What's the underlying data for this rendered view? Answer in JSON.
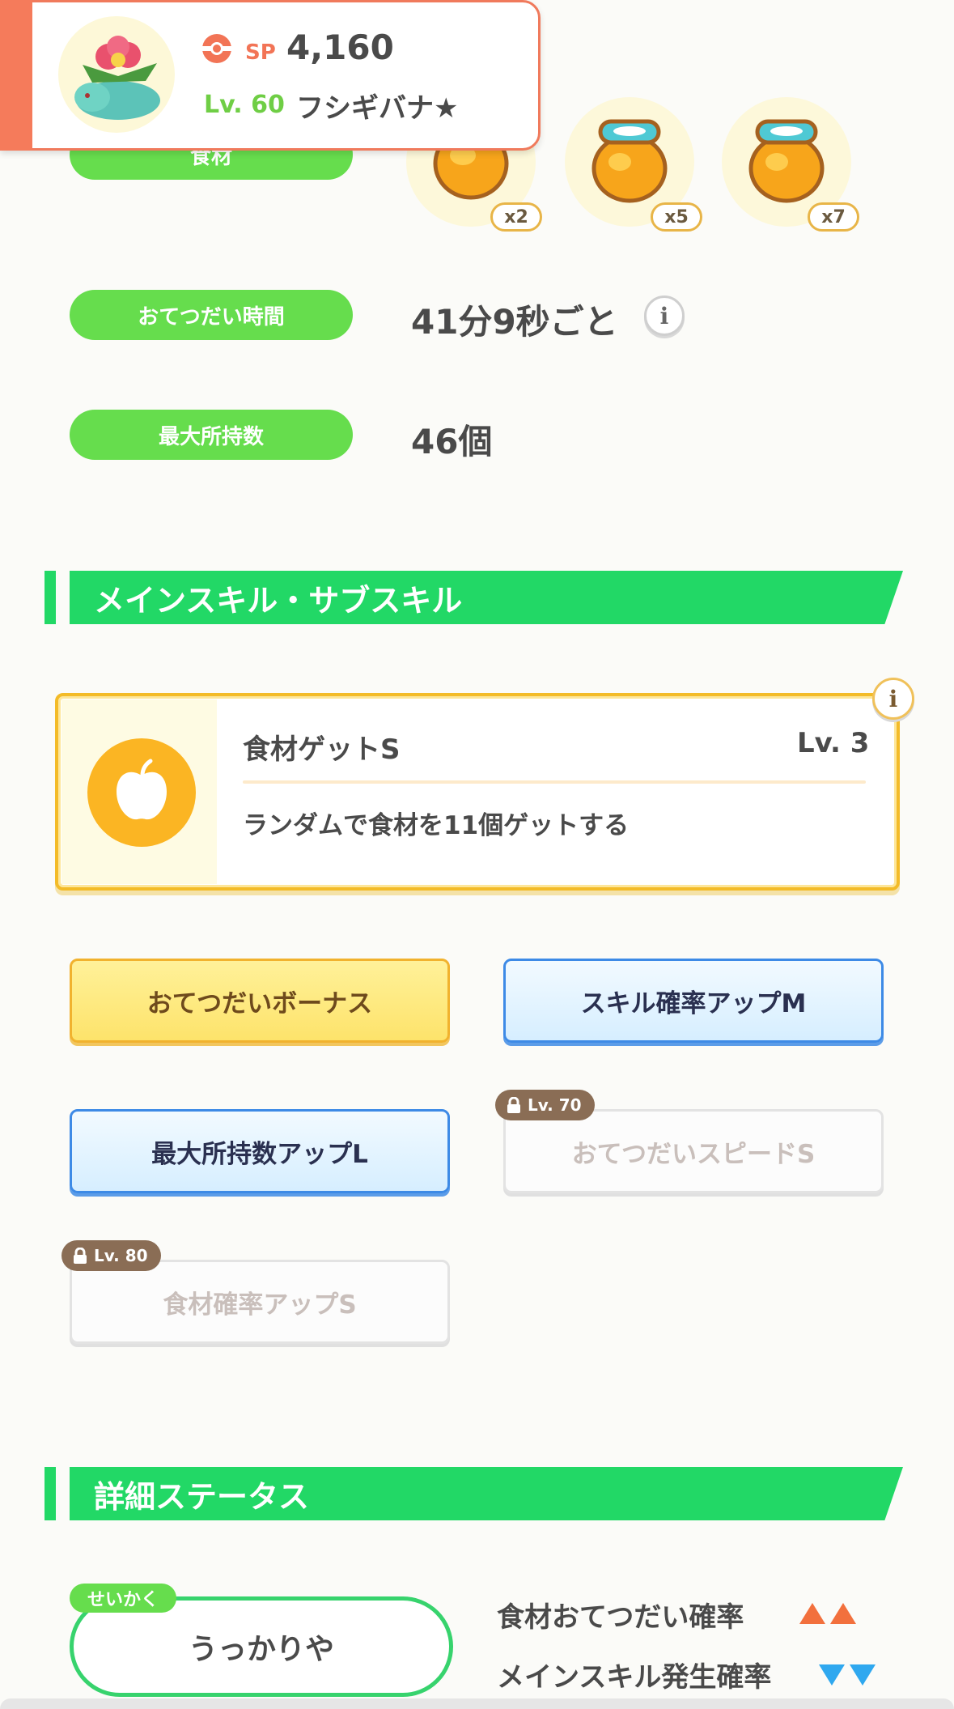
{
  "header": {
    "sp_label": "SP",
    "sp_value": "4,160",
    "level": "Lv. 60",
    "name": "フシギバナ★",
    "accent_color": "#f57b5b"
  },
  "ingredients": {
    "label": "食材",
    "items": [
      {
        "icon": "honey-jar-icon",
        "count": "x2"
      },
      {
        "icon": "honey-jar-icon",
        "count": "x5"
      },
      {
        "icon": "honey-jar-icon",
        "count": "x7"
      }
    ]
  },
  "help_time": {
    "label": "おてつだい時間",
    "value": "41分9秒ごと"
  },
  "max_carry": {
    "label": "最大所持数",
    "value": "46個"
  },
  "skills_section": {
    "title": "メインスキル・サブスキル",
    "main_skill": {
      "name": "食材ゲットS",
      "level": "Lv. 3",
      "description": "ランダムで食材を11個ゲットする",
      "icon": "apple-icon"
    },
    "sub_skills": [
      {
        "label": "おてつだいボーナス",
        "style": "gold"
      },
      {
        "label": "スキル確率アップM",
        "style": "blue"
      },
      {
        "label": "最大所持数アップL",
        "style": "blue"
      },
      {
        "label": "おてつだいスピードS",
        "style": "locked",
        "unlock": "Lv. 70"
      },
      {
        "label": "食材確率アップS",
        "style": "locked",
        "unlock": "Lv. 80"
      }
    ]
  },
  "details_section": {
    "title": "詳細ステータス",
    "nature_tag": "せいかく",
    "nature": "うっかりや",
    "stats": [
      {
        "label": "食材おてつだい確率",
        "direction": "up",
        "color": "#f2703d"
      },
      {
        "label": "メインスキル発生確率",
        "direction": "down",
        "color": "#2fa8ef"
      }
    ]
  }
}
